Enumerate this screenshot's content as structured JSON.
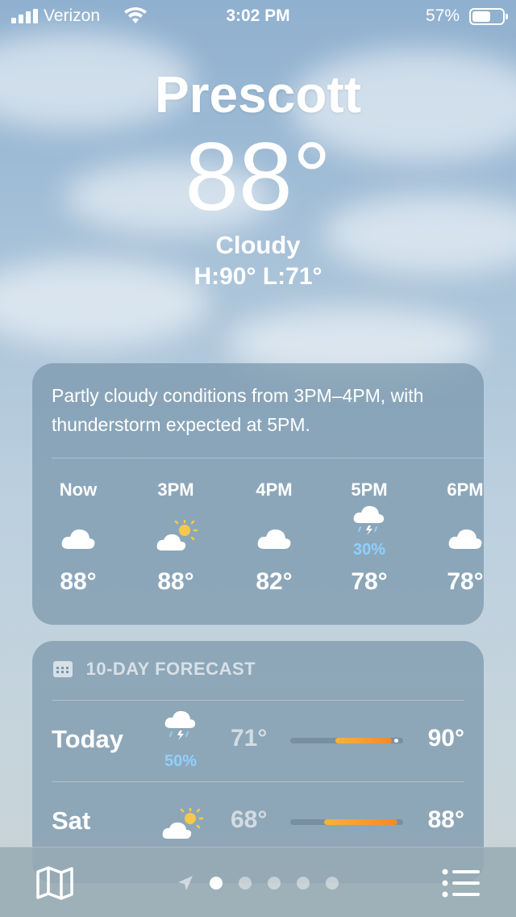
{
  "status_bar": {
    "carrier": "Verizon",
    "time": "3:02 PM",
    "battery": "57%"
  },
  "location": {
    "city": "Prescott",
    "temperature": "88°",
    "condition": "Cloudy",
    "high_low": "H:90°  L:71°"
  },
  "hourly": {
    "summary": "Partly cloudy conditions from 3PM–4PM, with thunderstorm expected at 5PM.",
    "hours": [
      {
        "label": "Now",
        "icon": "cloud-icon",
        "precip": "",
        "temp": "88°"
      },
      {
        "label": "3PM",
        "icon": "partly-sunny-icon",
        "precip": "",
        "temp": "88°"
      },
      {
        "label": "4PM",
        "icon": "cloud-icon",
        "precip": "",
        "temp": "82°"
      },
      {
        "label": "5PM",
        "icon": "thunderstorm-icon",
        "precip": "30%",
        "temp": "78°"
      },
      {
        "label": "6PM",
        "icon": "cloud-icon",
        "precip": "",
        "temp": "78°"
      }
    ]
  },
  "forecast": {
    "header": "10-DAY FORECAST",
    "days": [
      {
        "day": "Today",
        "icon": "thunderstorm-icon",
        "precip": "50%",
        "low": "71°",
        "high": "90°",
        "range_start": 0.4,
        "range_end": 0.9,
        "current": 0.94
      },
      {
        "day": "Sat",
        "icon": "partly-sunny-icon",
        "precip": "",
        "low": "68°",
        "high": "88°",
        "range_start": 0.3,
        "range_end": 0.95
      }
    ]
  },
  "toolbar": {
    "page_count": 5,
    "active_page": 1
  }
}
